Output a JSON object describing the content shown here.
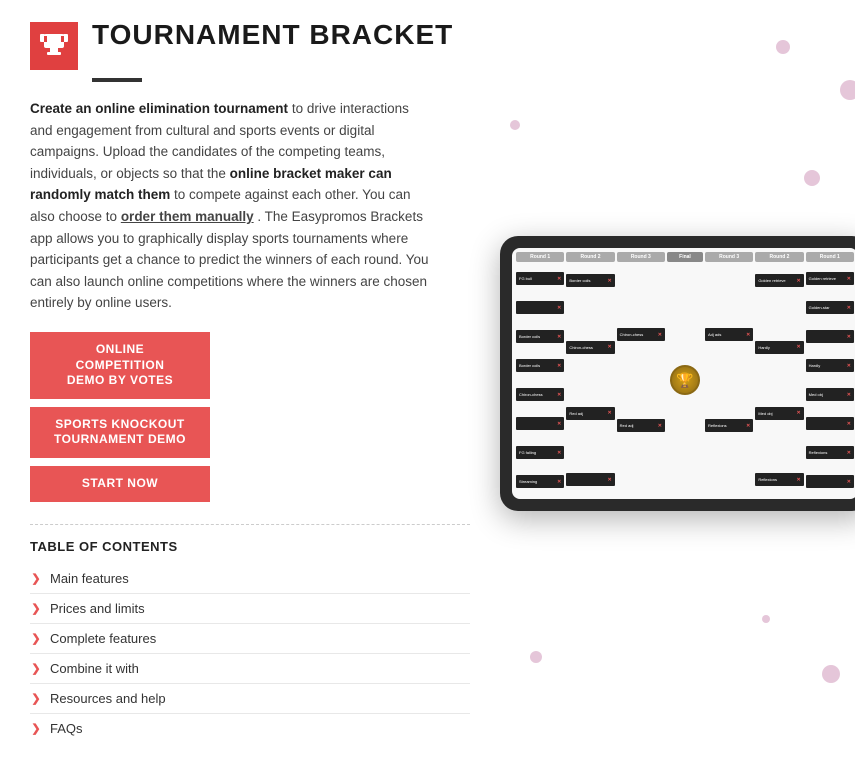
{
  "header": {
    "title": "TOURNAMENT BRACKET",
    "icon_label": "trophy-icon"
  },
  "description": {
    "part1": "Create an online elimination tournament",
    "part2": " to drive interactions and engagement from cultural and sports events or digital campaigns. Upload the candidates of the competing teams, individuals, or objects so that the ",
    "part3": "online bracket maker can randomly match them",
    "part4": " to compete against each other. You can also choose to ",
    "part5": "order them manually",
    "part6": ". The Easypromos Brackets app allows you to graphically display sports tournaments where participants get a chance to predict the winners of each round. You can also launch online competitions where the winners are chosen entirely by online users."
  },
  "buttons": [
    {
      "label": "ONLINE COMPETITION\nDEMO BY VOTES",
      "id": "btn-votes"
    },
    {
      "label": "SPORTS KNOCKOUT\nTOURNAMENT DEMO",
      "id": "btn-sports"
    },
    {
      "label": "START NOW",
      "id": "btn-start"
    }
  ],
  "toc": {
    "title": "TABLE OF CONTENTS",
    "items": [
      {
        "label": "Main features"
      },
      {
        "label": "Prices and limits"
      },
      {
        "label": "Complete features"
      },
      {
        "label": "Combine it with"
      },
      {
        "label": "Resources and help"
      },
      {
        "label": "FAQs"
      }
    ]
  },
  "bracket": {
    "rounds": [
      "Round 1",
      "Round 2",
      "Round 3",
      "Final",
      "Round 3",
      "Round 2",
      "Round 1"
    ],
    "teams": [
      [
        "FG ball",
        "",
        "Border coils",
        "Border coils",
        "Chiron-chess",
        "",
        "FG falling"
      ],
      [
        "Border coils",
        "",
        "Chiron-chess",
        "",
        "Red adj",
        "",
        ""
      ],
      [
        "Golden retrieve",
        "",
        "",
        "",
        "Adj ads",
        "",
        "Reflexions"
      ],
      [
        "Golden retrieve",
        "",
        "",
        "",
        "",
        "",
        "Golden-star"
      ]
    ]
  }
}
